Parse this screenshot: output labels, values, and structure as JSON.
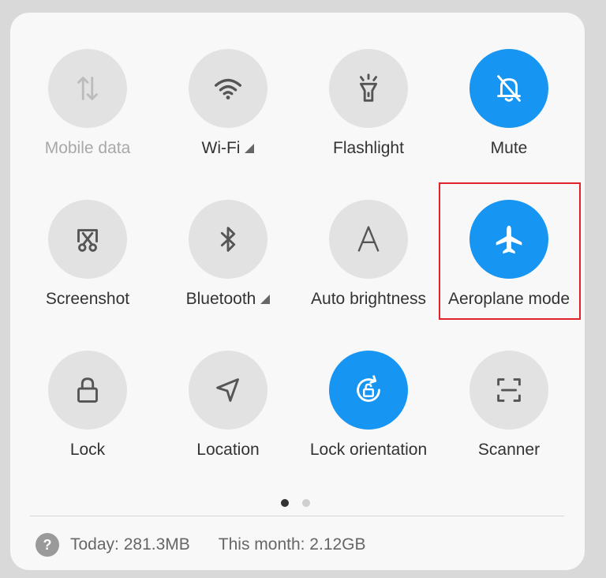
{
  "tiles": {
    "mobile_data": {
      "label": "Mobile data",
      "icon": "mobile-data-icon",
      "state": "disabled"
    },
    "wifi": {
      "label": "Wi-Fi",
      "icon": "wifi-icon",
      "state": "off",
      "has_expand": true
    },
    "flashlight": {
      "label": "Flashlight",
      "icon": "flashlight-icon",
      "state": "off"
    },
    "mute": {
      "label": "Mute",
      "icon": "mute-bell-icon",
      "state": "on"
    },
    "screenshot": {
      "label": "Screenshot",
      "icon": "screenshot-icon",
      "state": "off"
    },
    "bluetooth": {
      "label": "Bluetooth",
      "icon": "bluetooth-icon",
      "state": "off",
      "has_expand": true
    },
    "auto_brightness": {
      "label": "Auto brightness",
      "icon": "auto-brightness-icon",
      "state": "off"
    },
    "aeroplane_mode": {
      "label": "Aeroplane mode",
      "icon": "airplane-icon",
      "state": "on",
      "highlighted": true
    },
    "lock": {
      "label": "Lock",
      "icon": "lock-icon",
      "state": "off"
    },
    "location": {
      "label": "Location",
      "icon": "location-icon",
      "state": "off"
    },
    "lock_orientation": {
      "label": "Lock orientation",
      "icon": "rotation-lock-icon",
      "state": "on"
    },
    "scanner": {
      "label": "Scanner",
      "icon": "scanner-icon",
      "state": "off"
    }
  },
  "pagination": {
    "pages": 2,
    "current": 1
  },
  "footer": {
    "today": "Today: 281.3MB",
    "month": "This month: 2.12GB",
    "help_glyph": "?"
  },
  "colors": {
    "accent": "#1795f2",
    "tile_off": "#e2e2e2",
    "highlight_border": "#e0222a"
  }
}
